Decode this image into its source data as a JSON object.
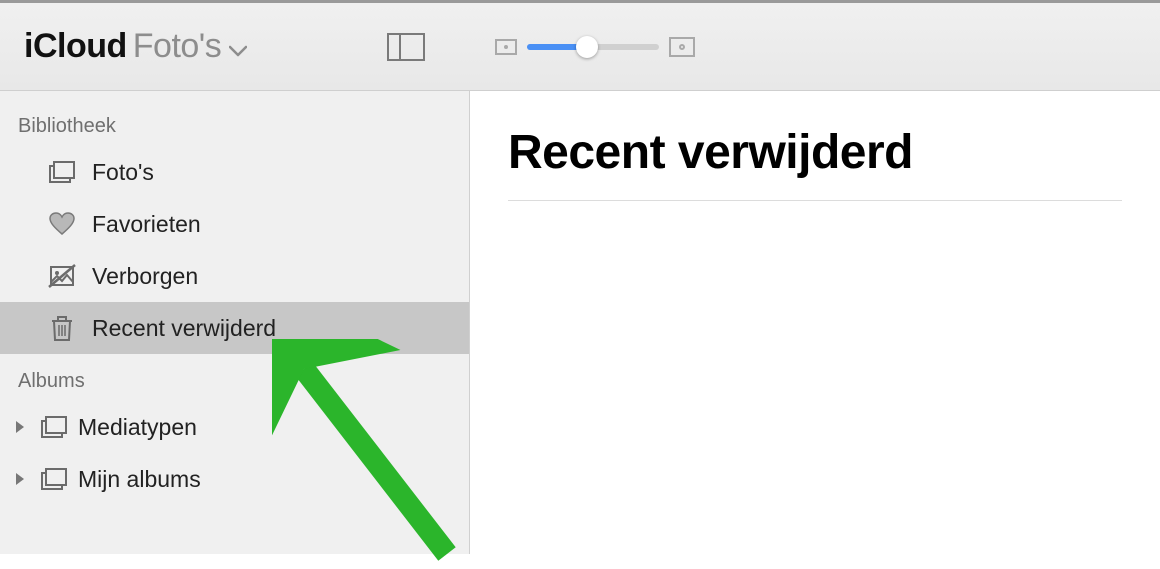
{
  "toolbar": {
    "app_name": "iCloud",
    "location": "Foto's",
    "slider_value": 45
  },
  "sidebar": {
    "section_library_label": "Bibliotheek",
    "section_albums_label": "Albums",
    "library_items": [
      {
        "id": "photos",
        "label": "Foto's",
        "icon": "photos-icon",
        "selected": false
      },
      {
        "id": "favorites",
        "label": "Favorieten",
        "icon": "heart-icon",
        "selected": false
      },
      {
        "id": "hidden",
        "label": "Verborgen",
        "icon": "strike-photo-icon",
        "selected": false
      },
      {
        "id": "recently-deleted",
        "label": "Recent verwijderd",
        "icon": "trash-icon",
        "selected": true
      }
    ],
    "album_items": [
      {
        "id": "mediatypes",
        "label": "Mediatypen"
      },
      {
        "id": "my-albums",
        "label": "Mijn albums"
      }
    ]
  },
  "content": {
    "title": "Recent verwijderd"
  },
  "annotation": {
    "color": "#2bb52b"
  }
}
